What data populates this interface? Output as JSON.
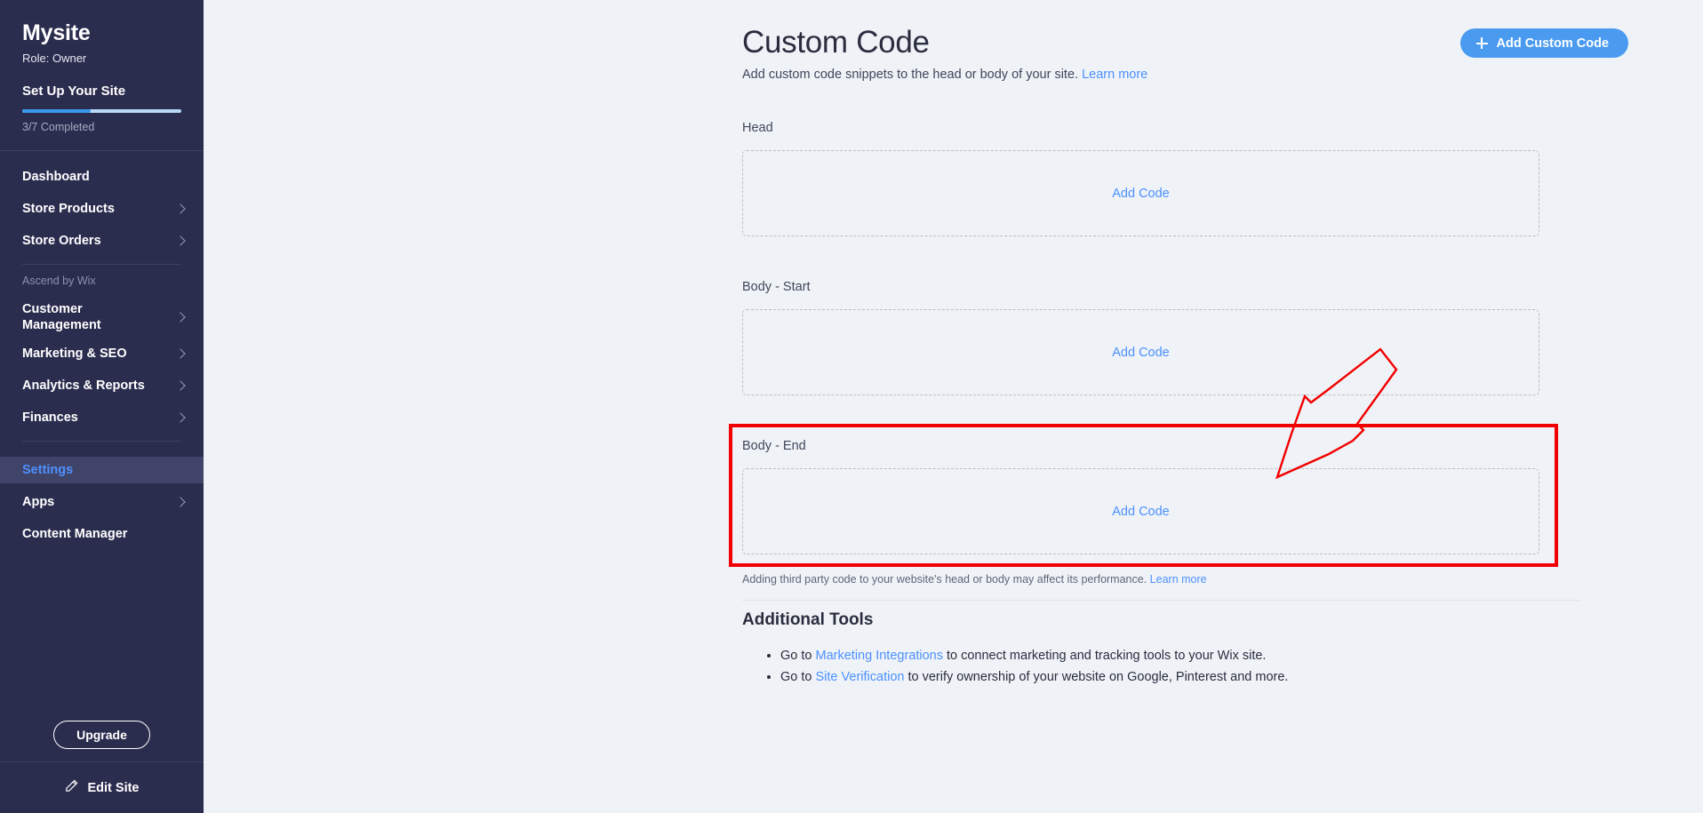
{
  "sidebar": {
    "site_title": "Mysite",
    "role": "Role: Owner",
    "setup_title": "Set Up Your Site",
    "progress": {
      "percent": 43,
      "label": "3/7 Completed"
    },
    "section_label": "Ascend by Wix",
    "items_primary": [
      {
        "label": "Dashboard",
        "chevron": false
      },
      {
        "label": "Store Products",
        "chevron": true
      },
      {
        "label": "Store Orders",
        "chevron": true
      }
    ],
    "items_ascend": [
      {
        "label": "Customer\nManagement",
        "chevron": true
      },
      {
        "label": "Marketing & SEO",
        "chevron": true
      },
      {
        "label": "Analytics & Reports",
        "chevron": true
      },
      {
        "label": "Finances",
        "chevron": true
      }
    ],
    "items_settings": [
      {
        "label": "Settings",
        "chevron": false,
        "active": true
      },
      {
        "label": "Apps",
        "chevron": true
      },
      {
        "label": "Content Manager",
        "chevron": false
      }
    ],
    "upgrade_label": "Upgrade",
    "edit_site_label": "Edit Site",
    "edit_site_icon": "pencil-icon"
  },
  "header": {
    "title": "Custom Code",
    "subtitle_text": "Add custom code snippets to the head or body of your site.",
    "subtitle_link": "Learn more",
    "add_button_label": "Add Custom Code",
    "add_button_icon": "plus-icon",
    "accent_color": "#4a9bf0"
  },
  "sections": [
    {
      "label": "Head",
      "action_label": "Add Code"
    },
    {
      "label": "Body - Start",
      "action_label": "Add Code"
    },
    {
      "label": "Body - End",
      "action_label": "Add Code",
      "highlighted": true
    }
  ],
  "footer_note": {
    "text": "Adding third party code to your website's head or body may affect its performance.",
    "link": "Learn more"
  },
  "additional_tools": {
    "title": "Additional Tools",
    "bullets": [
      {
        "pre": "Go to ",
        "link": "Marketing Integrations",
        "post": " to connect marketing and tracking tools to your Wix site."
      },
      {
        "pre": "Go to ",
        "link": "Site Verification",
        "post": " to verify ownership of your website on Google, Pinterest and more."
      }
    ]
  },
  "annotation": {
    "type": "red-highlight-box-and-arrow",
    "color": "#f20000",
    "target": "Body - End"
  }
}
